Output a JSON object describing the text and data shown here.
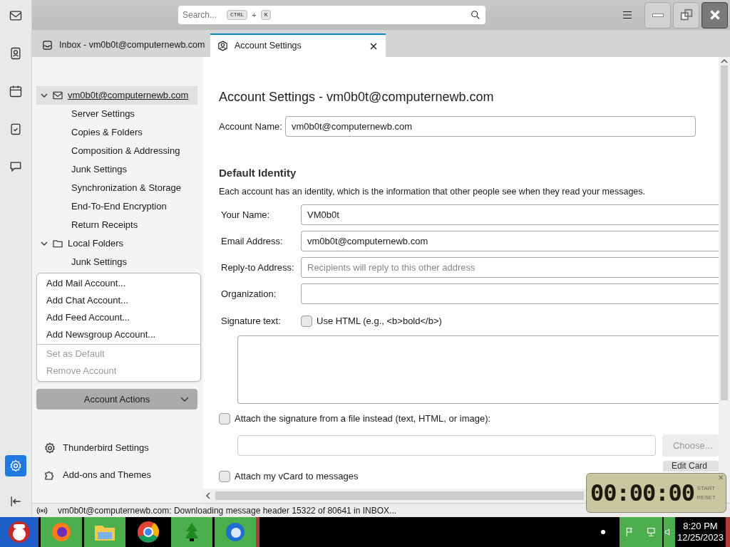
{
  "spaces_bar": [
    {
      "kind": "mail",
      "selected": false
    },
    {
      "kind": "contacts",
      "selected": false
    },
    {
      "kind": "calendar",
      "selected": false
    },
    {
      "kind": "tasks",
      "selected": false
    },
    {
      "kind": "chat",
      "selected": false
    }
  ],
  "settings_space": {
    "selected": true
  },
  "search": {
    "placeholder": "Search...",
    "keys": [
      "CTRL",
      "K"
    ],
    "joiner": "+"
  },
  "tabs": [
    {
      "kind": "inbox",
      "label": "Inbox - vm0b0t@computernewb.com",
      "selected": false
    },
    {
      "kind": "account",
      "label": "Account Settings",
      "selected": true
    }
  ],
  "account_tree": [
    {
      "kind": "mail",
      "label": "vm0b0t@computernewb.com",
      "selected": true,
      "expanded": true,
      "children": [
        {
          "label": "Server Settings"
        },
        {
          "label": "Copies & Folders"
        },
        {
          "label": "Composition & Addressing"
        },
        {
          "label": "Junk Settings"
        },
        {
          "label": "Synchronization & Storage"
        },
        {
          "label": "End-To-End Encryption"
        },
        {
          "label": "Return Receipts"
        }
      ]
    },
    {
      "kind": "folder",
      "label": "Local Folders",
      "selected": false,
      "expanded": true,
      "children": [
        {
          "label": "Junk Settings"
        }
      ]
    }
  ],
  "account_actions_menu": [
    {
      "kind": "item",
      "label": "Add Mail Account...",
      "disabled": false
    },
    {
      "kind": "item",
      "label": "Add Chat Account...",
      "disabled": false
    },
    {
      "kind": "item",
      "label": "Add Feed Account...",
      "disabled": false
    },
    {
      "kind": "item",
      "label": "Add Newsgroup Account...",
      "disabled": false
    },
    {
      "kind": "separator"
    },
    {
      "kind": "item",
      "label": "Set as Default",
      "disabled": true
    },
    {
      "kind": "item",
      "label": "Remove Account",
      "disabled": true
    }
  ],
  "account_actions_button": "Account Actions",
  "footer_links": [
    {
      "kind": "gear",
      "label": "Thunderbird Settings"
    },
    {
      "kind": "puzzle",
      "label": "Add-ons and Themes"
    }
  ],
  "page": {
    "title": "Account Settings - vm0b0t@computernewb.com",
    "account_name": {
      "label": "Account Name:",
      "value": "vm0b0t@computernewb.com"
    },
    "identity_title": "Default Identity",
    "identity_description": "Each account has an identity, which is the information that other people see when they read your messages.",
    "fields": [
      {
        "label": "Your Name:",
        "value": "VM0b0t"
      },
      {
        "label": "Email Address:",
        "value": "vm0b0t@computernewb.com"
      },
      {
        "label": "Reply-to Address:",
        "placeholder": "Recipients will reply to this other address"
      },
      {
        "label": "Organization:"
      }
    ],
    "signature_label": "Signature text:",
    "use_html": {
      "label": "Use HTML (e.g., <b>bold</b>)",
      "checked": false
    },
    "attach_signature": {
      "label": "Attach the signature from a file instead (text, HTML, or image):",
      "checked": false
    },
    "choose_button": "Choose...",
    "vcard": {
      "label": "Attach my vCard to messages",
      "checked": false
    },
    "edit_card_button": "Edit Card"
  },
  "status_bar": "vm0b0t@computernewb.com: Downloading message header 15322 of 80641 in INBOX...",
  "timer": {
    "display": "00:00:00",
    "buttons": [
      "START",
      "RESET"
    ],
    "close": "✕"
  },
  "taskbar": {
    "time": "8:20 PM",
    "date": "12/25/2023"
  }
}
